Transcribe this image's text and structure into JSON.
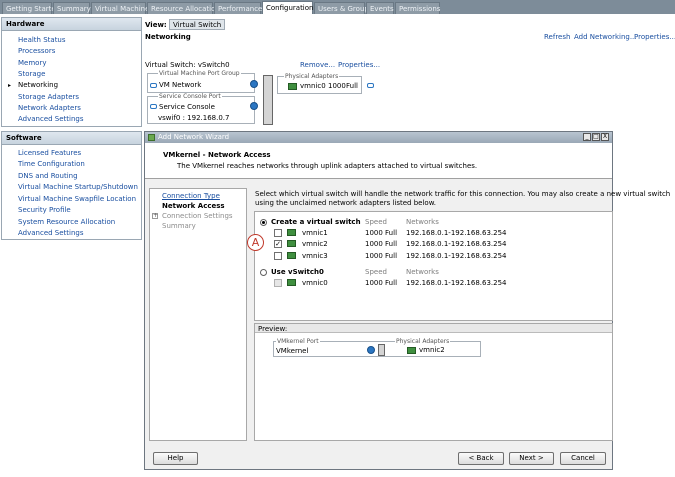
{
  "tabs": [
    {
      "label": "Getting Started",
      "active": false
    },
    {
      "label": "Summary",
      "active": false
    },
    {
      "label": "Virtual Machines",
      "active": false
    },
    {
      "label": "Resource Allocation",
      "active": false
    },
    {
      "label": "Performance",
      "active": false
    },
    {
      "label": "Configuration",
      "active": true
    },
    {
      "label": "Users & Groups",
      "active": false
    },
    {
      "label": "Events",
      "active": false
    },
    {
      "label": "Permissions",
      "active": false
    }
  ],
  "hardware": {
    "title": "Hardware",
    "items": [
      "Health Status",
      "Processors",
      "Memory",
      "Storage",
      "Networking",
      "Storage Adapters",
      "Network Adapters",
      "Advanced Settings"
    ],
    "current": "Networking"
  },
  "software": {
    "title": "Software",
    "items": [
      "Licensed Features",
      "Time Configuration",
      "DNS and Routing",
      "Virtual Machine Startup/Shutdown",
      "Virtual Machine Swapfile Location",
      "Security Profile",
      "System Resource Allocation",
      "Advanced Settings"
    ]
  },
  "view": {
    "label": "View:",
    "value": "Virtual Switch"
  },
  "networking": {
    "title": "Networking",
    "links": {
      "refresh": "Refresh",
      "add": "Add Networking...",
      "properties": "Properties..."
    },
    "vswitch_label": "Virtual Switch: vSwitch0",
    "remove": "Remove...",
    "properties": "Properties...",
    "vm_port_group_label": "Virtual Machine Port Group",
    "vm_network": "VM Network",
    "sc_port_label": "Service Console Port",
    "service_console": "Service Console",
    "vswif": "vswif0 : 192.168.0.7",
    "phys_label": "Physical Adapters",
    "vmnic": "vmnic0",
    "speed": "1000",
    "duplex": "Full"
  },
  "wizard": {
    "title": "Add Network Wizard",
    "header_title": "VMkernel - Network Access",
    "header_sub": "The VMkernel reaches networks through uplink adapters attached to virtual switches.",
    "steps": [
      "Connection Type",
      "Network Access",
      "Connection Settings",
      "Summary"
    ],
    "instructions_1": "Select which virtual switch will handle the network traffic for this connection. You may also create a new virtual switch",
    "instructions_2": "using the unclaimed network adapters listed below.",
    "create_label": "Create a virtual switch",
    "use_label": "Use vSwitch0",
    "col_speed": "Speed",
    "col_networks": "Networks",
    "create_rows": [
      {
        "nic": "vmnic1",
        "speed": "1000 Full",
        "networks": "192.168.0.1-192.168.63.254",
        "checked": false
      },
      {
        "nic": "vmnic2",
        "speed": "1000 Full",
        "networks": "192.168.0.1-192.168.63.254",
        "checked": true
      },
      {
        "nic": "vmnic3",
        "speed": "1000 Full",
        "networks": "192.168.0.1-192.168.63.254",
        "checked": false
      }
    ],
    "use_rows": [
      {
        "nic": "vmnic0",
        "speed": "1000 Full",
        "networks": "192.168.0.1-192.168.63.254"
      }
    ],
    "preview_label": "Preview:",
    "preview_port_label": "VMkernel Port",
    "preview_port": "VMkernel",
    "preview_phys_label": "Physical Adapters",
    "preview_nic": "vmnic2",
    "buttons": {
      "help": "Help",
      "back": "< Back",
      "next": "Next >",
      "cancel": "Cancel"
    },
    "window_buttons": [
      "_",
      "□",
      "X"
    ]
  },
  "callout": "A",
  "colors": {
    "link": "#1a4fa0",
    "nic": "#3f8f3f",
    "accent": "#2b76c2",
    "callout": "#c0392b"
  }
}
